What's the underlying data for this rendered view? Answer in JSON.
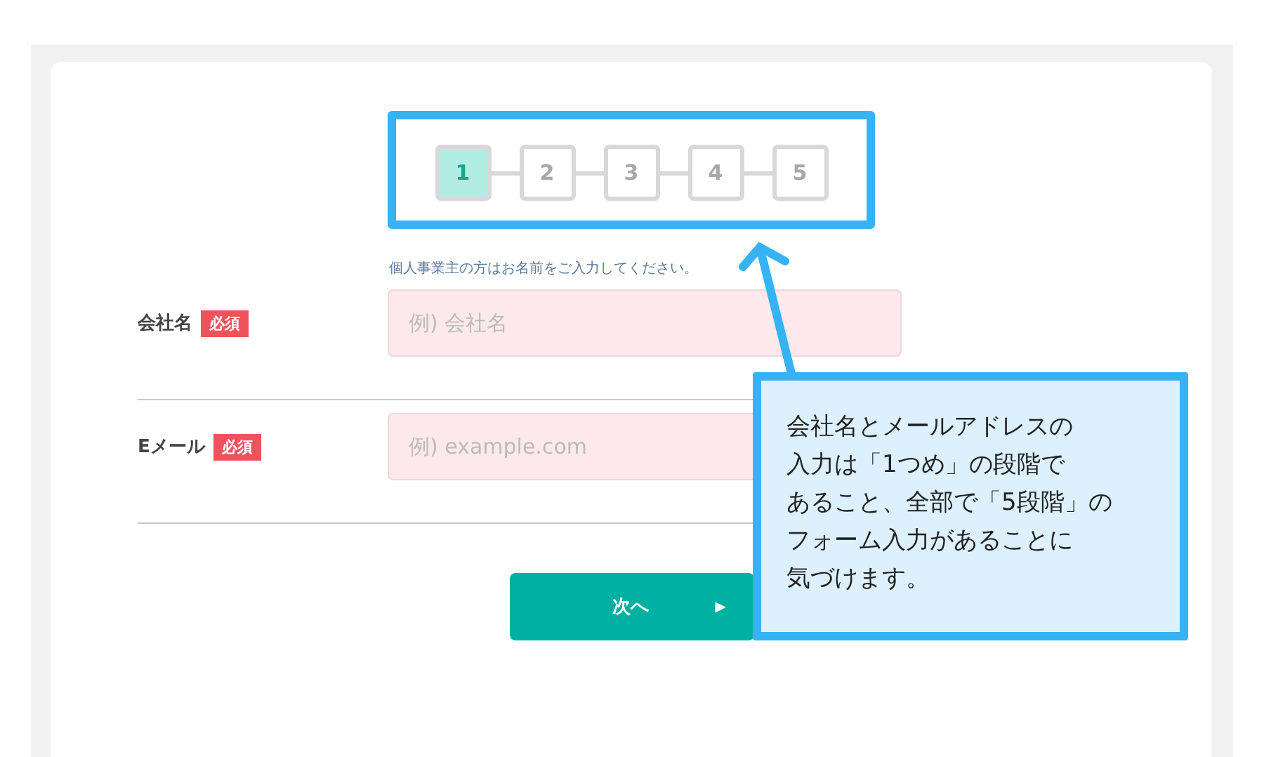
{
  "steps": [
    {
      "label": "1",
      "selected": true
    },
    {
      "label": "2",
      "selected": false
    },
    {
      "label": "3",
      "selected": false
    },
    {
      "label": "4",
      "selected": false
    },
    {
      "label": "5",
      "selected": false
    }
  ],
  "hint": "個人事業主の方はお名前をご入力してください。",
  "fields": [
    {
      "label": "会社名",
      "badge": "必須",
      "placeholder": "例) 会社名"
    },
    {
      "label": "Eメール",
      "badge": "必須",
      "placeholder": "例) example.com"
    }
  ],
  "next_button": {
    "label": "次へ",
    "arrow": "▶"
  },
  "callout": {
    "lines": [
      "会社名とメールアドレスの",
      "入力は「1つめ」の段階で",
      "あること、全部で「5段階」の",
      "フォーム入力があることに",
      "気づけます。"
    ]
  }
}
